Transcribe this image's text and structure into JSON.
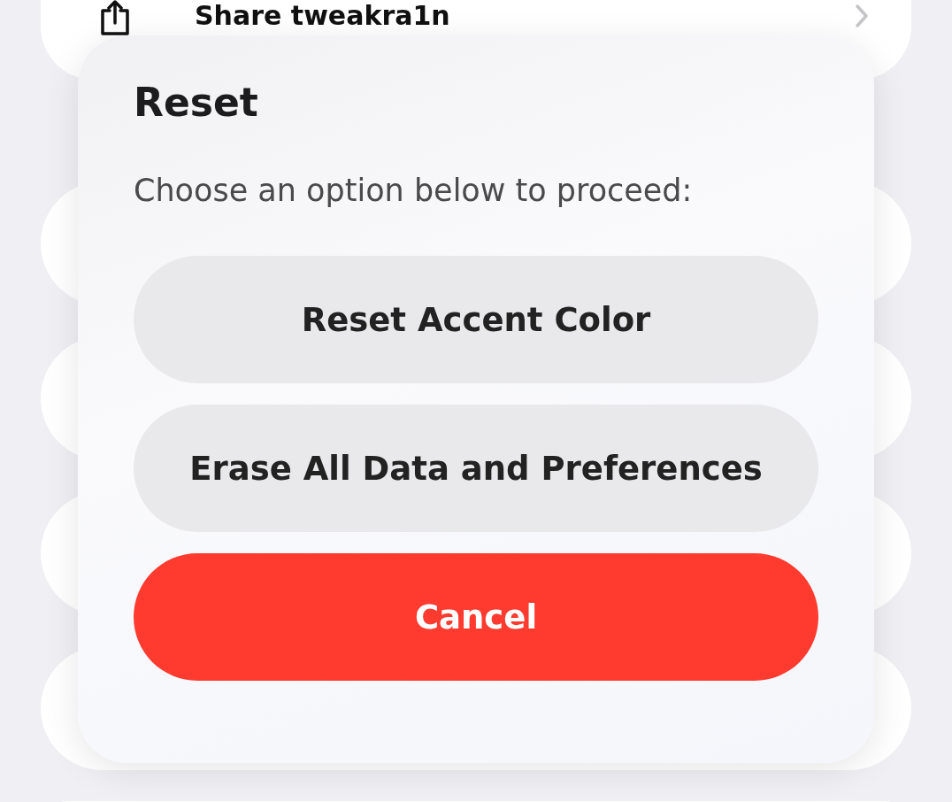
{
  "settings_list": {
    "rows": [
      {
        "label": "Share tweakra1n"
      }
    ]
  },
  "dialog": {
    "title": "Reset",
    "message": "Choose an option below to proceed:",
    "buttons": [
      {
        "label": "Reset Accent Color",
        "kind": "default"
      },
      {
        "label": "Erase All Data and Preferences",
        "kind": "default"
      },
      {
        "label": "Cancel",
        "kind": "destructive"
      }
    ]
  }
}
